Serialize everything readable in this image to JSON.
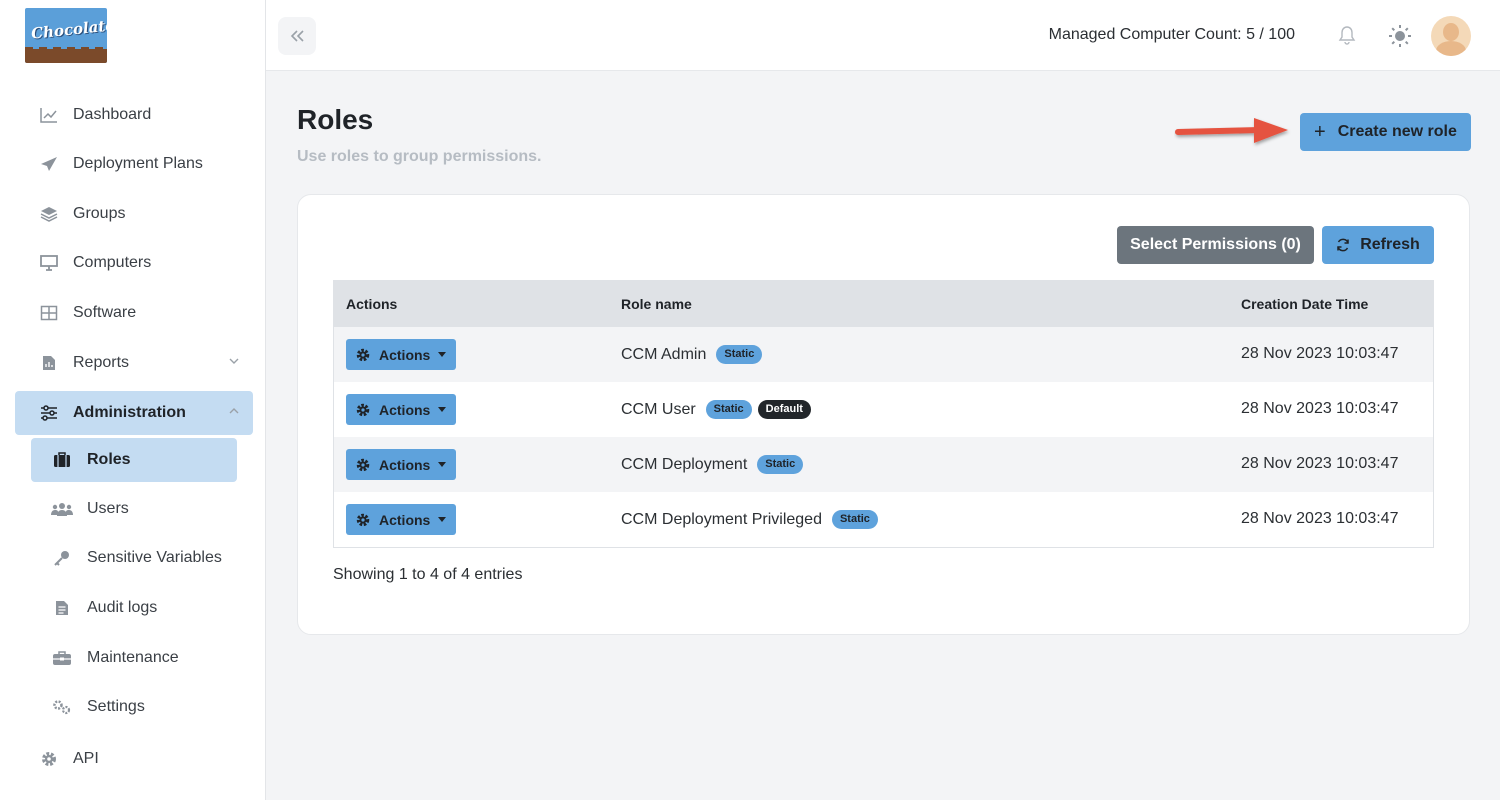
{
  "brand": {
    "logo_text": "Chocolatey"
  },
  "sidebar": {
    "items": [
      {
        "label": "Dashboard",
        "icon": "chart-line-icon"
      },
      {
        "label": "Deployment Plans",
        "icon": "paper-plane-icon"
      },
      {
        "label": "Groups",
        "icon": "layers-icon"
      },
      {
        "label": "Computers",
        "icon": "monitor-icon"
      },
      {
        "label": "Software",
        "icon": "grid-icon"
      },
      {
        "label": "Reports",
        "icon": "file-chart-icon"
      },
      {
        "label": "Administration",
        "icon": "sliders-icon"
      }
    ],
    "sub_items": [
      {
        "label": "Roles",
        "icon": "briefcase-icon"
      },
      {
        "label": "Users",
        "icon": "users-icon"
      },
      {
        "label": "Sensitive Variables",
        "icon": "key-icon"
      },
      {
        "label": "Audit logs",
        "icon": "file-text-icon"
      },
      {
        "label": "Maintenance",
        "icon": "toolbox-icon"
      },
      {
        "label": "Settings",
        "icon": "gears-icon"
      }
    ],
    "api": {
      "label": "API",
      "icon": "gear-icon"
    }
  },
  "header": {
    "managed_count": "Managed Computer Count: 5 / 100"
  },
  "page": {
    "title": "Roles",
    "subtitle": "Use roles to group permissions.",
    "create_label": "Create new role"
  },
  "toolbar": {
    "select_permissions_label": "Select Permissions (0)",
    "refresh_label": "Refresh"
  },
  "table": {
    "headers": [
      "Actions",
      "Role name",
      "Creation Date Time"
    ],
    "action_label": "Actions",
    "rows": [
      {
        "name": "CCM Admin",
        "badges": [
          "Static"
        ],
        "date": "28 Nov 2023 10:03:47"
      },
      {
        "name": "CCM User",
        "badges": [
          "Static",
          "Default"
        ],
        "date": "28 Nov 2023 10:03:47"
      },
      {
        "name": "CCM Deployment",
        "badges": [
          "Static"
        ],
        "date": "28 Nov 2023 10:03:47"
      },
      {
        "name": "CCM Deployment Privileged",
        "badges": [
          "Static"
        ],
        "date": "28 Nov 2023 10:03:47"
      }
    ]
  },
  "footer": {
    "info": "Showing 1 to 4 of 4 entries"
  },
  "colors": {
    "accent": "#5ea2dc",
    "active_bg": "#c4dcf2",
    "arrow": "#e5523f",
    "secondary": "#6c757d"
  }
}
